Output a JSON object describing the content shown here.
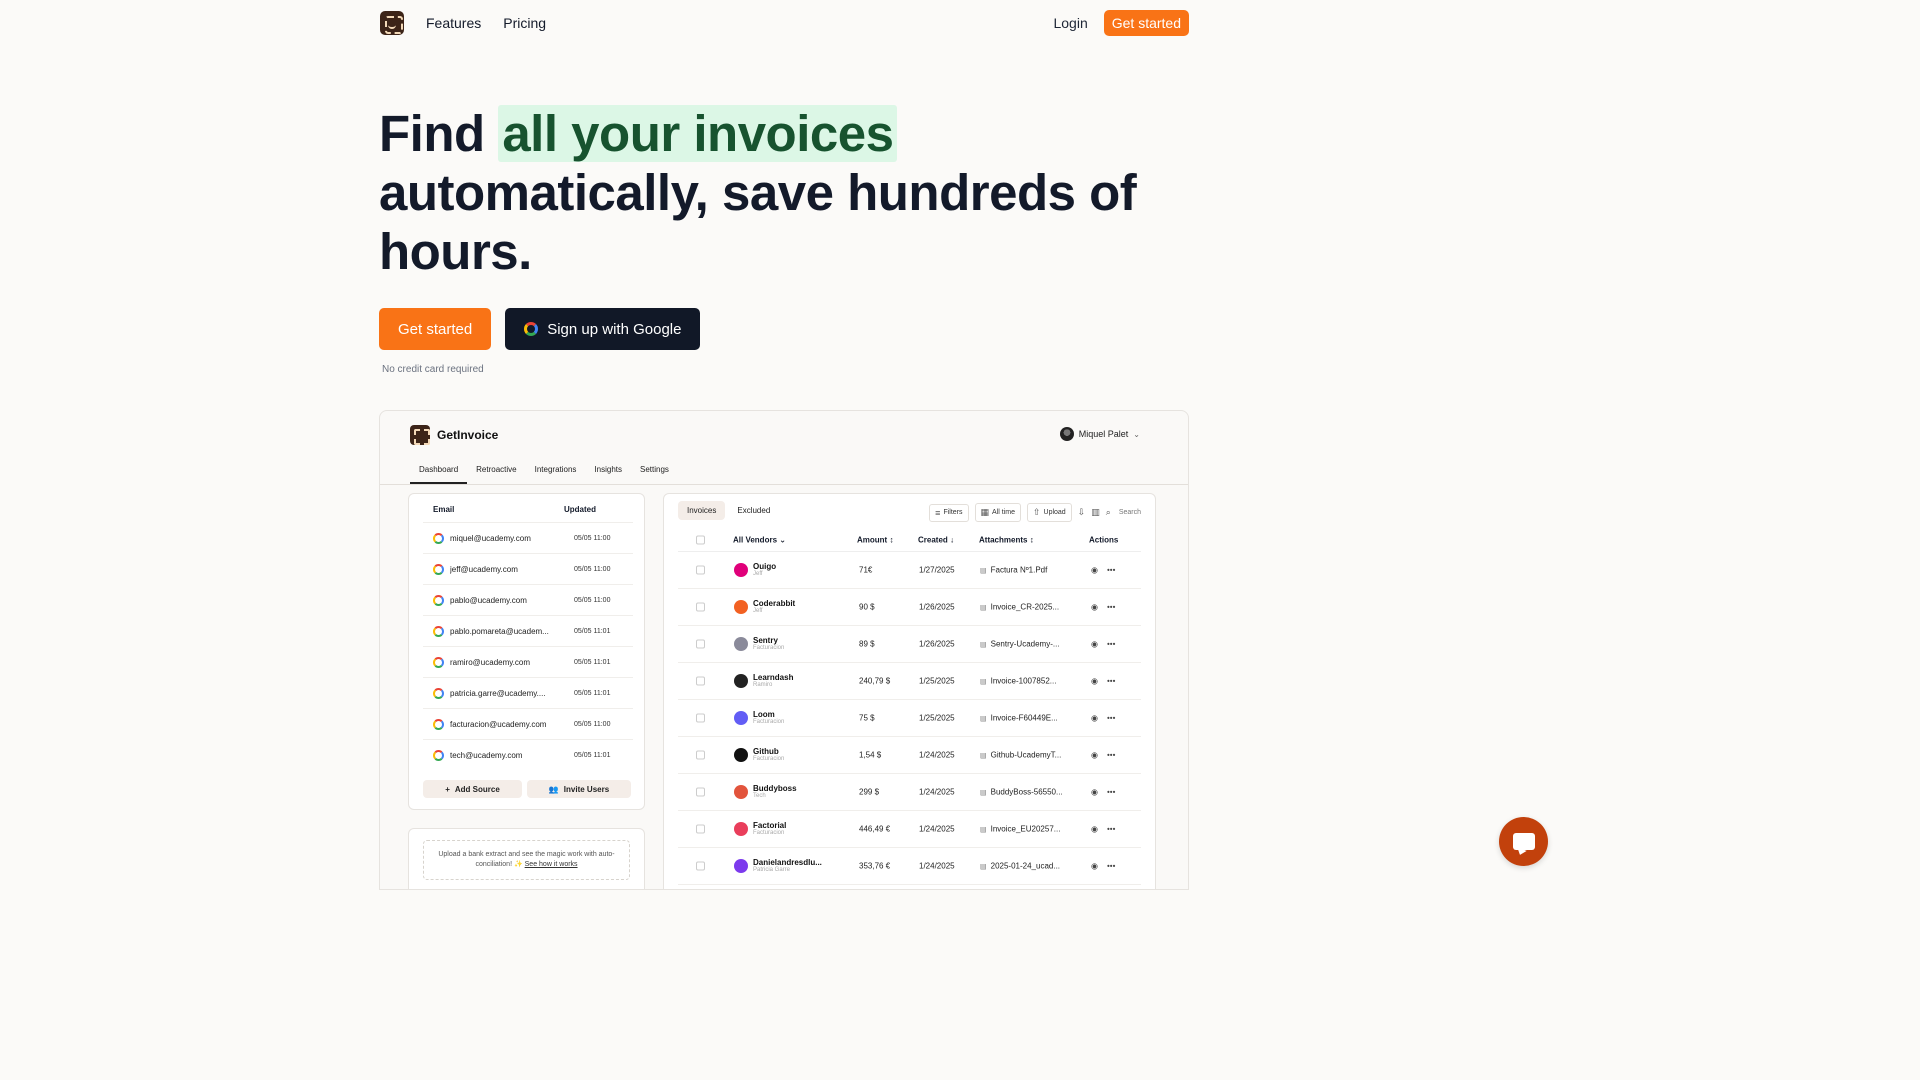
{
  "nav": {
    "links": [
      "Features",
      "Pricing"
    ],
    "login": "Login",
    "get_started": "Get started"
  },
  "hero": {
    "line_start": "Find ",
    "highlight": "all your invoices",
    "line_rest": " automatically, save hundreds of hours."
  },
  "cta": {
    "primary": "Get started",
    "google": "Sign up with Google",
    "note": "No credit card required"
  },
  "app": {
    "title": "GetInvoice",
    "user": "Miquel Palet",
    "tabs": [
      "Dashboard",
      "Retroactive",
      "Integrations",
      "Insights",
      "Settings"
    ],
    "email_table": {
      "headers": [
        "Email",
        "Updated"
      ],
      "rows": [
        {
          "email": "miquel@ucademy.com",
          "updated": "05/05 11:00"
        },
        {
          "email": "jeff@ucademy.com",
          "updated": "05/05 11:00"
        },
        {
          "email": "pablo@ucademy.com",
          "updated": "05/05 11:00"
        },
        {
          "email": "pablo.pomareta@ucadem...",
          "updated": "05/05 11:01"
        },
        {
          "email": "ramiro@ucademy.com",
          "updated": "05/05 11:01"
        },
        {
          "email": "patricia.garre@ucademy....",
          "updated": "05/05 11:01"
        },
        {
          "email": "facturacion@ucademy.com",
          "updated": "05/05 11:00"
        },
        {
          "email": "tech@ucademy.com",
          "updated": "05/05 11:01"
        }
      ],
      "add_source": "Add Source",
      "invite_users": "Invite Users"
    },
    "upload": {
      "text": "Upload a bank extract and see the magic work with auto-conciliation! ✨",
      "link": "See how it works"
    },
    "invoices": {
      "tabs": [
        "Invoices",
        "Excluded"
      ],
      "toolbar": {
        "filters": "Filters",
        "all_time": "All time",
        "upload": "Upload",
        "search": "Search"
      },
      "headers": {
        "vendor": "All Vendors",
        "amount": "Amount",
        "created": "Created",
        "attachments": "Attachments",
        "actions": "Actions"
      },
      "rows": [
        {
          "vendor": "Ouigo",
          "sub": "Jeff",
          "amount": "71€",
          "created": "1/27/2025",
          "file": "Factura Nº1.Pdf",
          "color": "#e0007a"
        },
        {
          "vendor": "Coderabbit",
          "sub": "Jeff",
          "amount": "90 $",
          "created": "1/26/2025",
          "file": "Invoice_CR-2025...",
          "color": "#f26122"
        },
        {
          "vendor": "Sentry",
          "sub": "Facturacion",
          "amount": "89 $",
          "created": "1/26/2025",
          "file": "Sentry-Ucademy-...",
          "color": "#8a8a9a"
        },
        {
          "vendor": "Learndash",
          "sub": "Ramiro",
          "amount": "240,79 $",
          "created": "1/25/2025",
          "file": "Invoice-1007852...",
          "color": "#222222"
        },
        {
          "vendor": "Loom",
          "sub": "Facturacion",
          "amount": "75 $",
          "created": "1/25/2025",
          "file": "Invoice-F60449E...",
          "color": "#625df5"
        },
        {
          "vendor": "Github",
          "sub": "Facturacion",
          "amount": "1,54 $",
          "created": "1/24/2025",
          "file": "Github-UcademyT...",
          "color": "#111111"
        },
        {
          "vendor": "Buddyboss",
          "sub": "Tech",
          "amount": "299 $",
          "created": "1/24/2025",
          "file": "BuddyBoss-56550...",
          "color": "#e2543c"
        },
        {
          "vendor": "Factorial",
          "sub": "Facturacion",
          "amount": "446,49 €",
          "created": "1/24/2025",
          "file": "Invoice_EU20257...",
          "color": "#e93e5b"
        },
        {
          "vendor": "Danielandresdlu...",
          "sub": "Patricia Garre",
          "amount": "353,76 €",
          "created": "1/24/2025",
          "file": "2025-01-24_ucad...",
          "color": "#7c3aed"
        }
      ]
    }
  },
  "colors": {
    "accent": "#f97316",
    "dark": "#111827",
    "highlight_bg": "#dcf7e6",
    "highlight_fg": "#17532f",
    "chat": "#c2410c"
  }
}
